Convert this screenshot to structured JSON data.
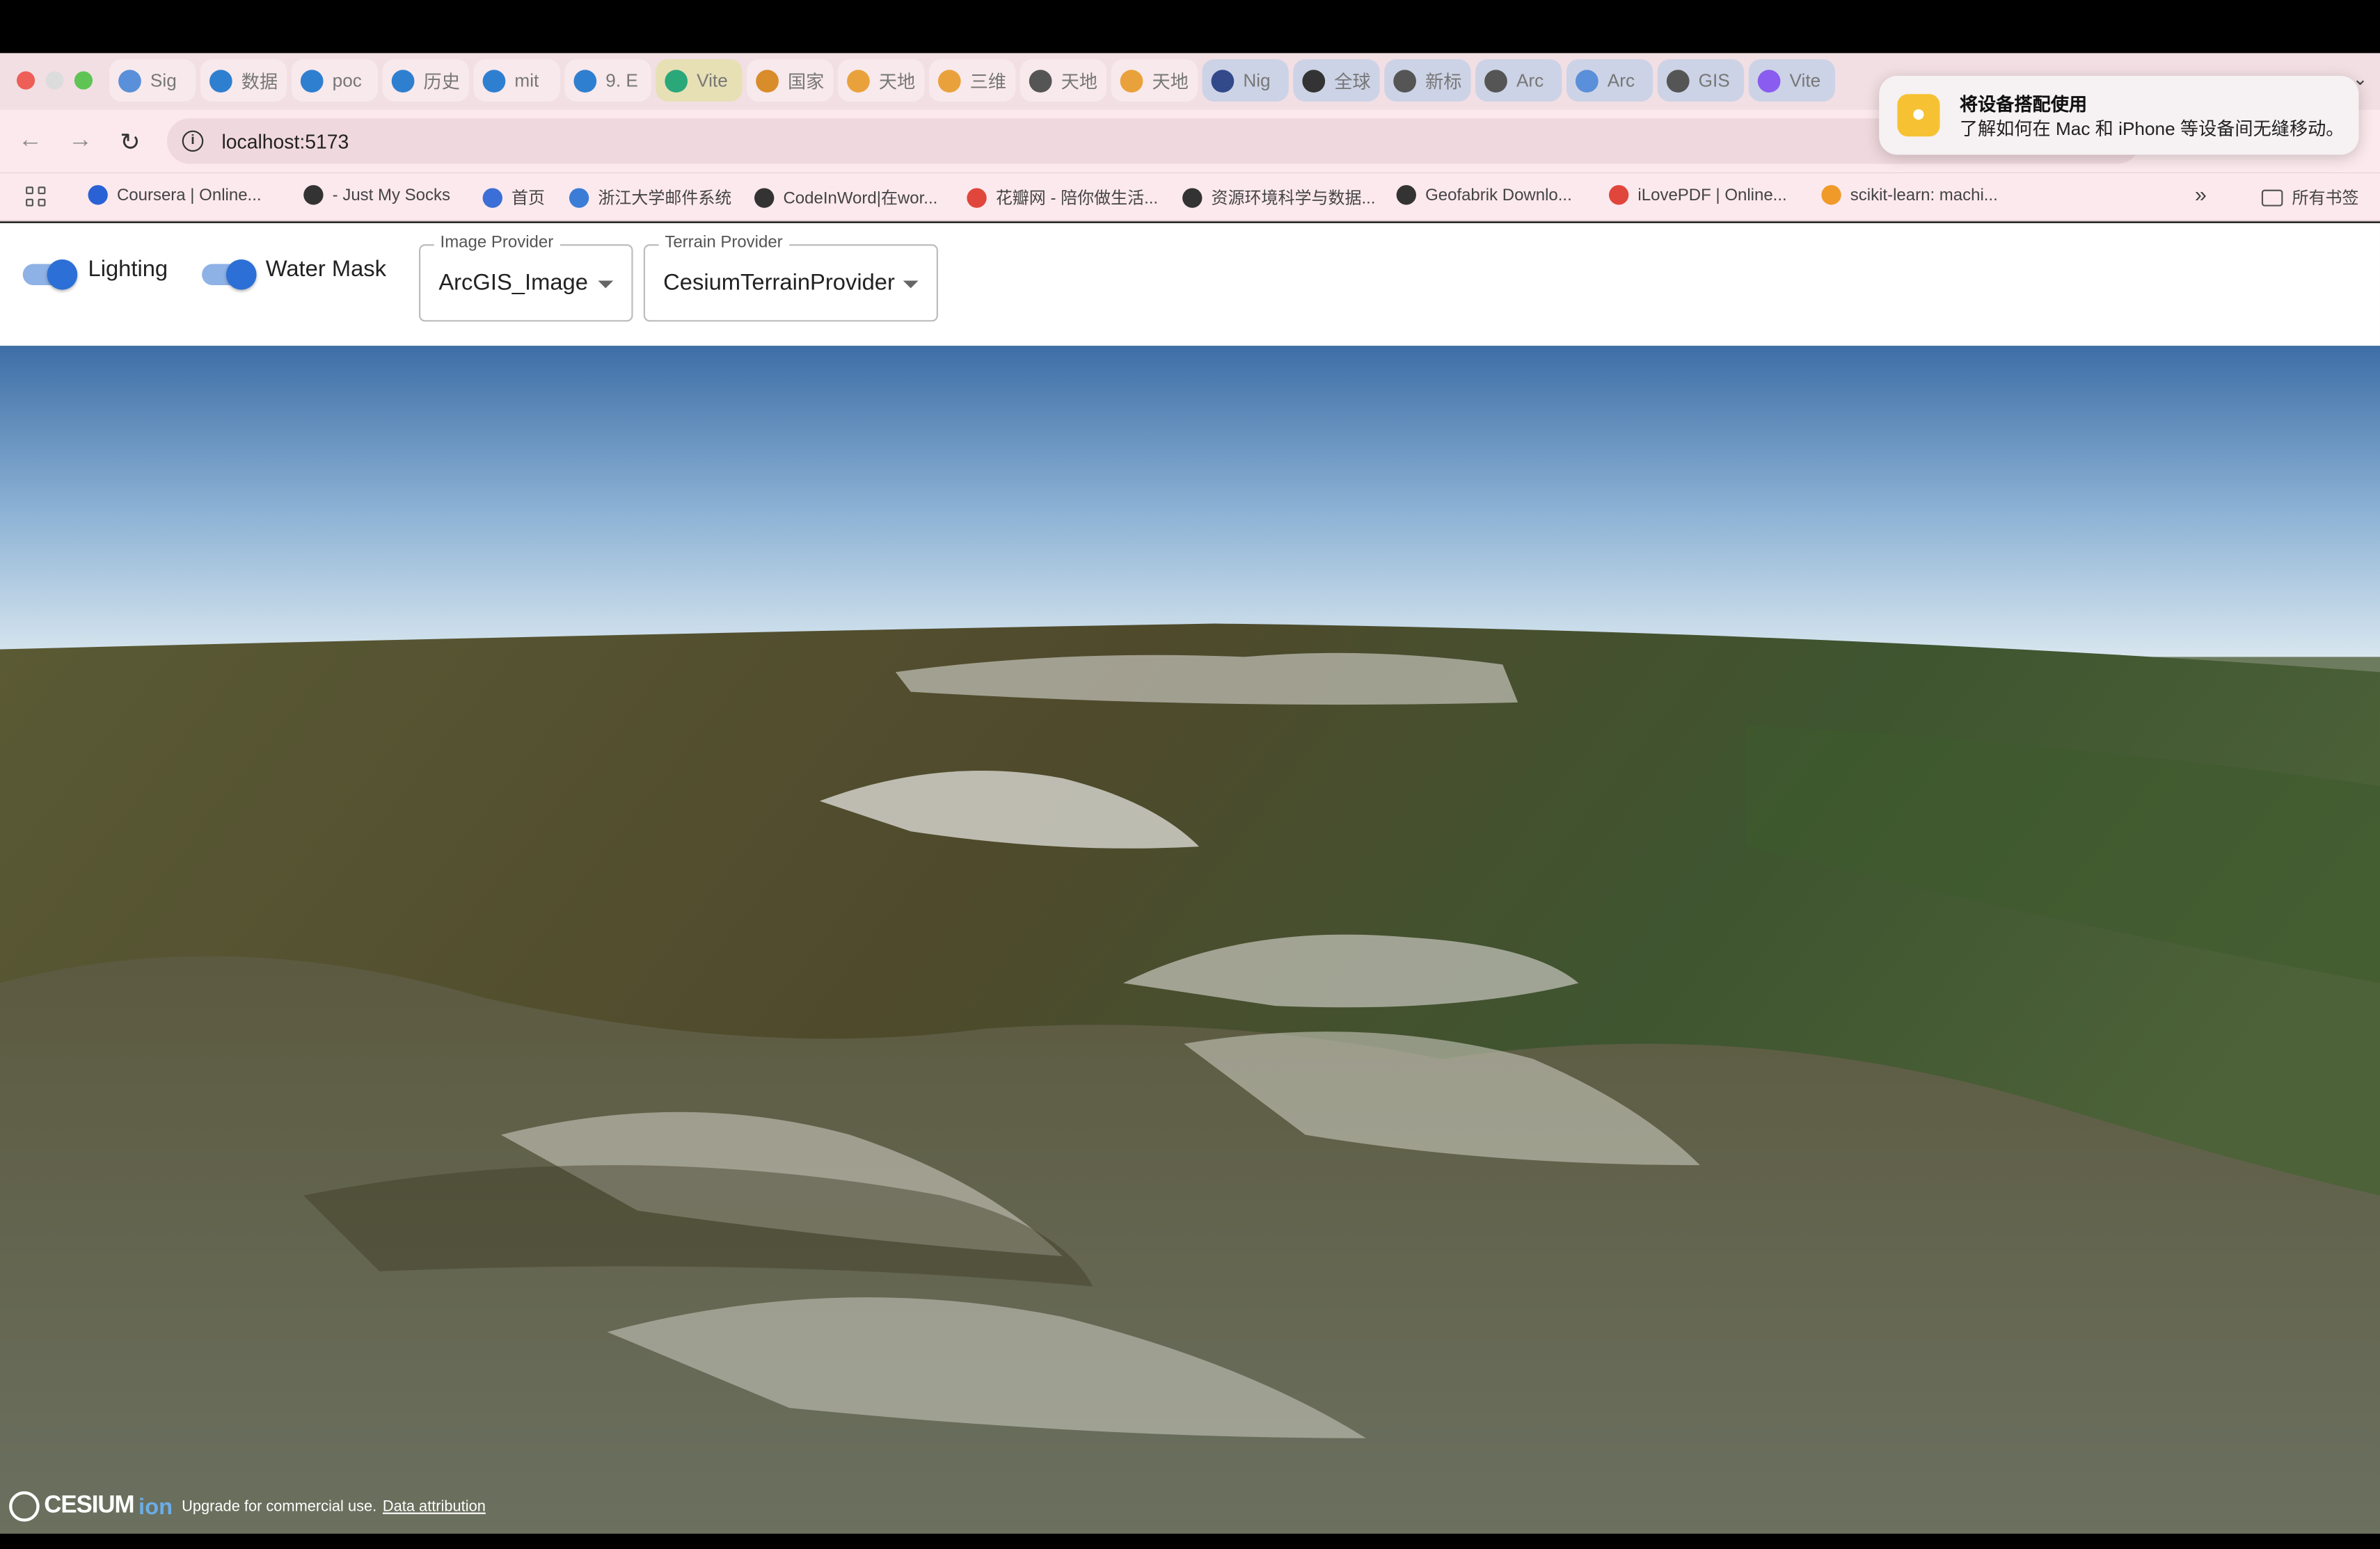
{
  "browser": {
    "tabs": [
      {
        "label": "Sig",
        "color": "#5a8fd9"
      },
      {
        "label": "数据",
        "color": "#2f7fd1"
      },
      {
        "label": "poc",
        "color": "#2f7fd1"
      },
      {
        "label": "历史",
        "color": "#2f7fd1"
      },
      {
        "label": "mit",
        "color": "#2f7fd1"
      },
      {
        "label": "9. E",
        "color": "#2f7fd1"
      },
      {
        "label": "Vite",
        "color": "#2aa87a"
      },
      {
        "label": "国家",
        "color": "#d98c2a"
      },
      {
        "label": "天地",
        "color": "#e9a23b"
      },
      {
        "label": "三维",
        "color": "#e9a23b"
      },
      {
        "label": "天地",
        "color": "#555555"
      },
      {
        "label": "天地",
        "color": "#e9a23b"
      },
      {
        "label": "Nig",
        "color": "#324a8a"
      },
      {
        "label": "全球",
        "color": "#333333"
      },
      {
        "label": "新标",
        "color": "#555555"
      },
      {
        "label": "Arc",
        "color": "#555555"
      },
      {
        "label": "Arc",
        "color": "#5a8fd9"
      },
      {
        "label": "GIS",
        "color": "#555555"
      },
      {
        "label": "Vite",
        "color": "#8a5cf0"
      }
    ],
    "url": "localhost:5173",
    "bookmarks": [
      {
        "label": "Coursera | Online...",
        "color": "#2a62d6"
      },
      {
        "label": "- Just My Socks",
        "color": "#333333"
      },
      {
        "label": "首页",
        "color": "#3b6ed6"
      },
      {
        "label": "浙江大学邮件系统",
        "color": "#3b7dd6"
      },
      {
        "label": "CodeInWord|在wor...",
        "color": "#333333"
      },
      {
        "label": "花瓣网 - 陪你做生活...",
        "color": "#e0463b"
      },
      {
        "label": "资源环境科学与数据...",
        "color": "#333333"
      },
      {
        "label": "Geofabrik Downlo...",
        "color": "#333333"
      },
      {
        "label": "iLovePDF | Online...",
        "color": "#e0463b"
      },
      {
        "label": "scikit-learn: machi...",
        "color": "#f09a2a"
      }
    ],
    "all_bookmarks": "所有书签",
    "notification": {
      "title": "将设备搭配使用",
      "body": "了解如何在 Mac 和 iPhone 等设备间无缝移动。"
    }
  },
  "controls": {
    "lighting_label": "Lighting",
    "lighting_on": true,
    "watermask_label": "Water Mask",
    "watermask_on": true,
    "image_provider_label": "Image Provider",
    "image_provider_value": "ArcGIS_Image",
    "terrain_provider_label": "Terrain Provider",
    "terrain_provider_value": "CesiumTerrainProvider"
  },
  "viewer": {
    "logo_text": "CESIUM",
    "logo_suffix": "ion",
    "credit_text": "Upgrade for commercial use.",
    "credit_link": "Data attribution"
  }
}
